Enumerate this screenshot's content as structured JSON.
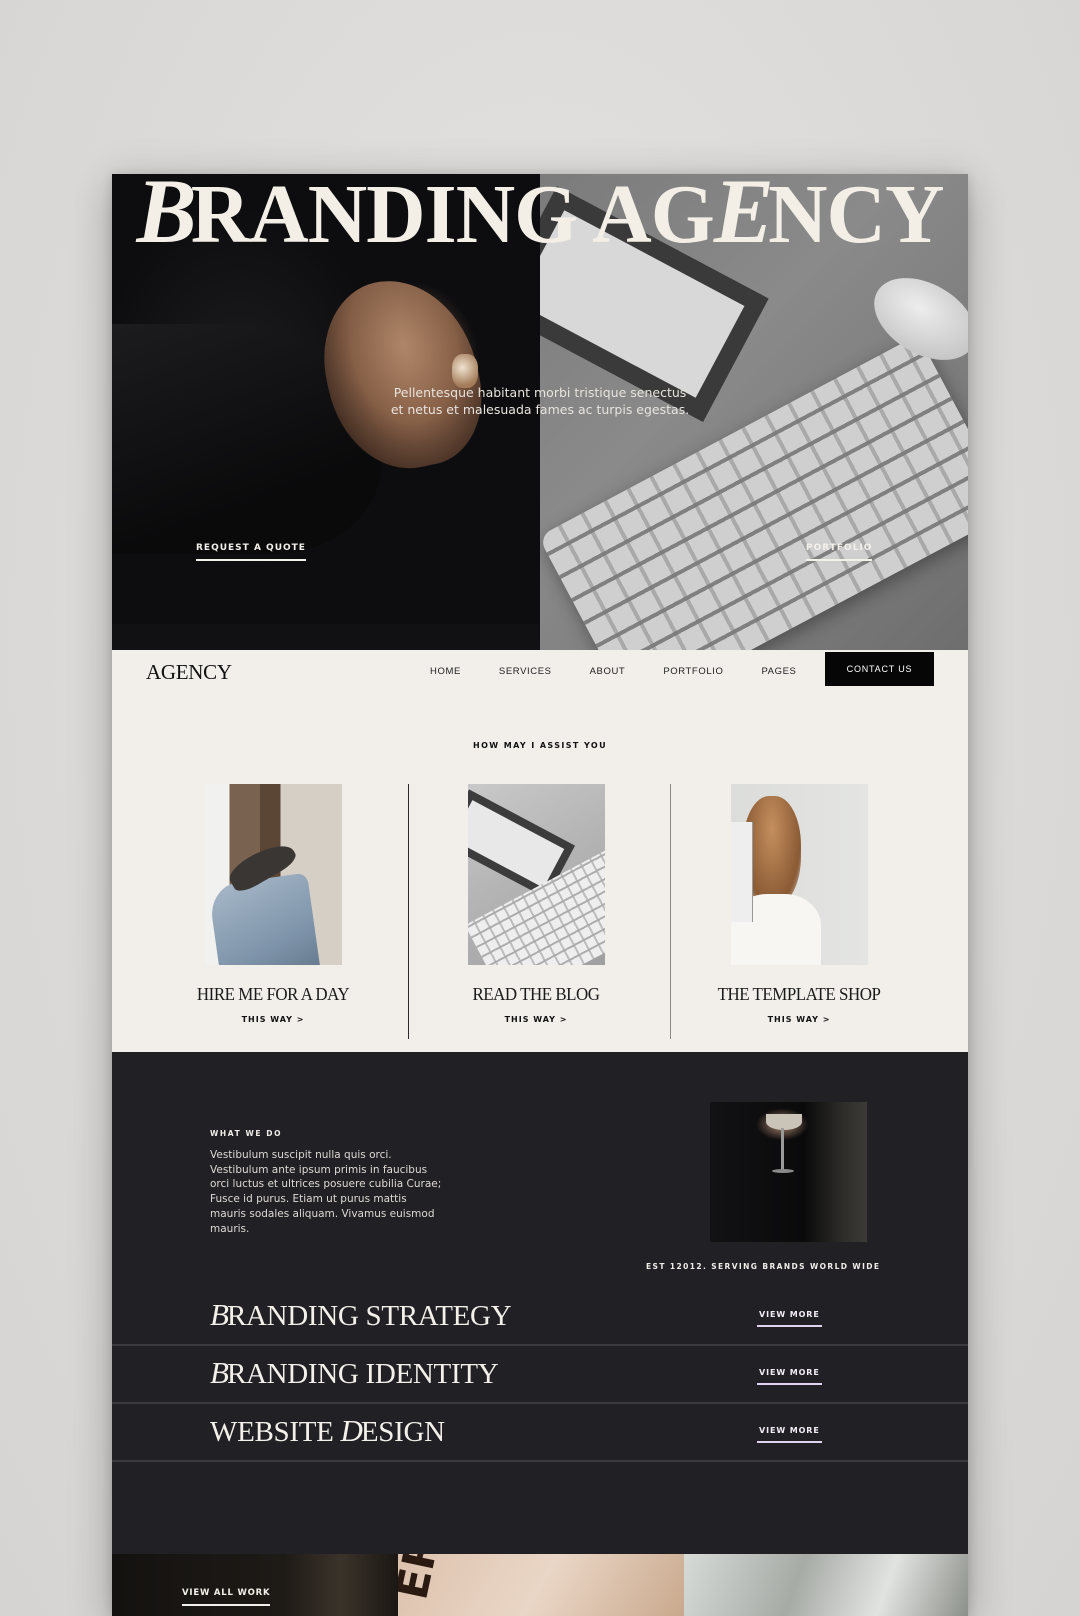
{
  "hero": {
    "title_script_initial": "B",
    "title_part1": "RANDING AG",
    "title_script_mid": "E",
    "title_part2": "NCY",
    "tagline": "Pellentesque habitant morbi tristique senectus et netus et malesuada fames ac turpis egestas.",
    "cta_quote": "REQUEST A QUOTE",
    "cta_portfolio": "PORTFOLIO"
  },
  "nav": {
    "logo": "AGENCY",
    "items": [
      {
        "label": "HOME"
      },
      {
        "label": "SERVICES"
      },
      {
        "label": "ABOUT"
      },
      {
        "label": "PORTFOLIO"
      },
      {
        "label": "PAGES"
      }
    ],
    "contact_label": "CONTACT US"
  },
  "assist": {
    "heading": "HOW MAY I ASSIST YOU",
    "cards": [
      {
        "title": "HIRE ME FOR A DAY",
        "link": "THIS WAY >"
      },
      {
        "title": "READ THE BLOG",
        "link": "THIS WAY >"
      },
      {
        "title": "THE TEMPLATE SHOP",
        "link": "THIS WAY >"
      }
    ]
  },
  "services": {
    "label": "WHAT WE DO",
    "body": "Vestibulum suscipit nulla quis orci. Vestibulum ante ipsum primis in faucibus orci luctus et ultrices posuere cubilia Curae; Fusce id purus. Etiam ut purus mattis mauris sodales aliquam. Vivamus euismod mauris.",
    "est_line": "EST 12012. SERVING BRANDS WORLD WIDE",
    "items": [
      {
        "prefix": "",
        "cap": "B",
        "rest": "RANDING STRATEGY",
        "link": "VIEW MORE"
      },
      {
        "prefix": "",
        "cap": "B",
        "rest": "RANDING IDENTITY",
        "link": "VIEW MORE"
      },
      {
        "prefix": "WEBSITE ",
        "cap": "D",
        "rest": "ESIGN",
        "link": "VIEW MORE"
      }
    ]
  },
  "portfolio": {
    "view_all": "VIEW ALL WORK"
  },
  "colors": {
    "page_bg": "#f2efeb",
    "dark_section": "#212025",
    "accent_underline": "#e1d4ee",
    "button_bg": "#060606"
  }
}
